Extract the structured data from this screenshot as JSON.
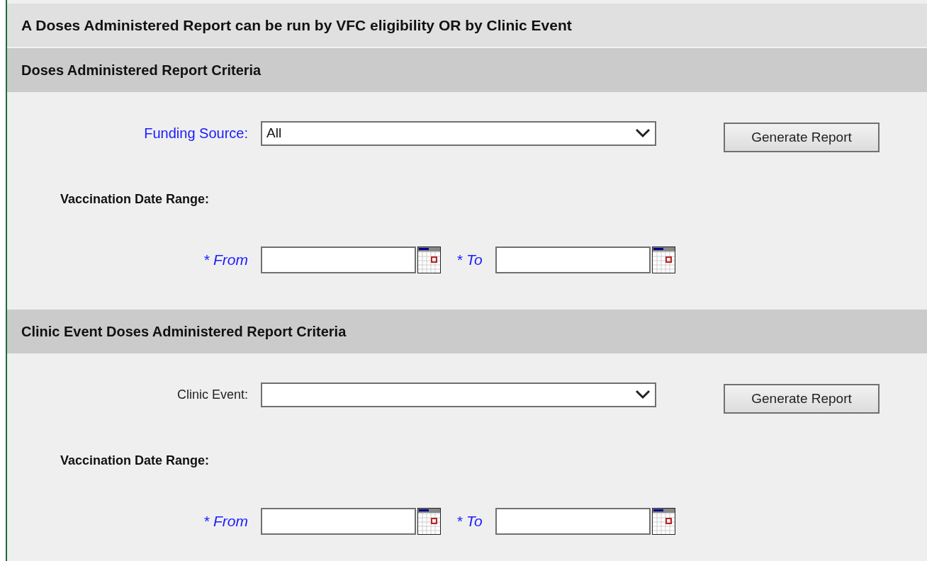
{
  "banner": "A Doses Administered Report can be run by VFC eligibility OR by Clinic Event",
  "sections": [
    {
      "title": "Doses Administered Report Criteria",
      "select": {
        "label": "Funding Source:",
        "required": true,
        "value": "All"
      },
      "button": "Generate Report",
      "range_label": "Vaccination Date Range:",
      "from_label": "* From",
      "to_label": "* To"
    },
    {
      "title": "Clinic Event Doses Administered Report Criteria",
      "select": {
        "label": "Clinic Event:",
        "required": false
      },
      "button": "Generate Report",
      "range_label": "Vaccination Date Range:",
      "from_label": "* From",
      "to_label": "* To"
    }
  ]
}
